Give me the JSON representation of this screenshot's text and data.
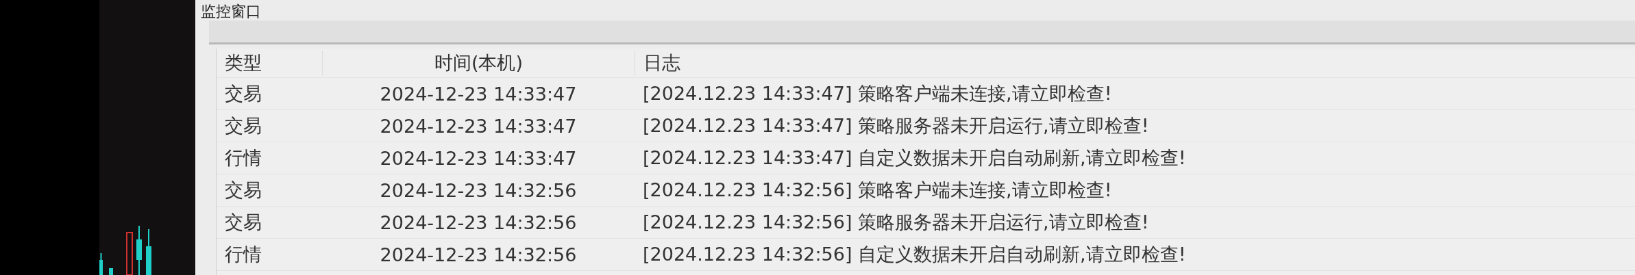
{
  "window": {
    "title": "监控窗口"
  },
  "table": {
    "columns": [
      "类型",
      "时间(本机)",
      "日志"
    ],
    "rows": [
      {
        "type": "交易",
        "time": "2024-12-23 14:33:47",
        "log": "[2024.12.23 14:33:47] 策略客户端未连接,请立即检查!"
      },
      {
        "type": "交易",
        "time": "2024-12-23 14:33:47",
        "log": "[2024.12.23 14:33:47] 策略服务器未开启运行,请立即检查!"
      },
      {
        "type": "行情",
        "time": "2024-12-23 14:33:47",
        "log": "[2024.12.23 14:33:47] 自定义数据未开启自动刷新,请立即检查!"
      },
      {
        "type": "交易",
        "time": "2024-12-23 14:32:56",
        "log": "[2024.12.23 14:32:56] 策略客户端未连接,请立即检查!"
      },
      {
        "type": "交易",
        "time": "2024-12-23 14:32:56",
        "log": "[2024.12.23 14:32:56] 策略服务器未开启运行,请立即检查!"
      },
      {
        "type": "行情",
        "time": "2024-12-23 14:32:56",
        "log": "[2024.12.23 14:32:56] 自定义数据未开启自动刷新,请立即检查!"
      }
    ]
  }
}
